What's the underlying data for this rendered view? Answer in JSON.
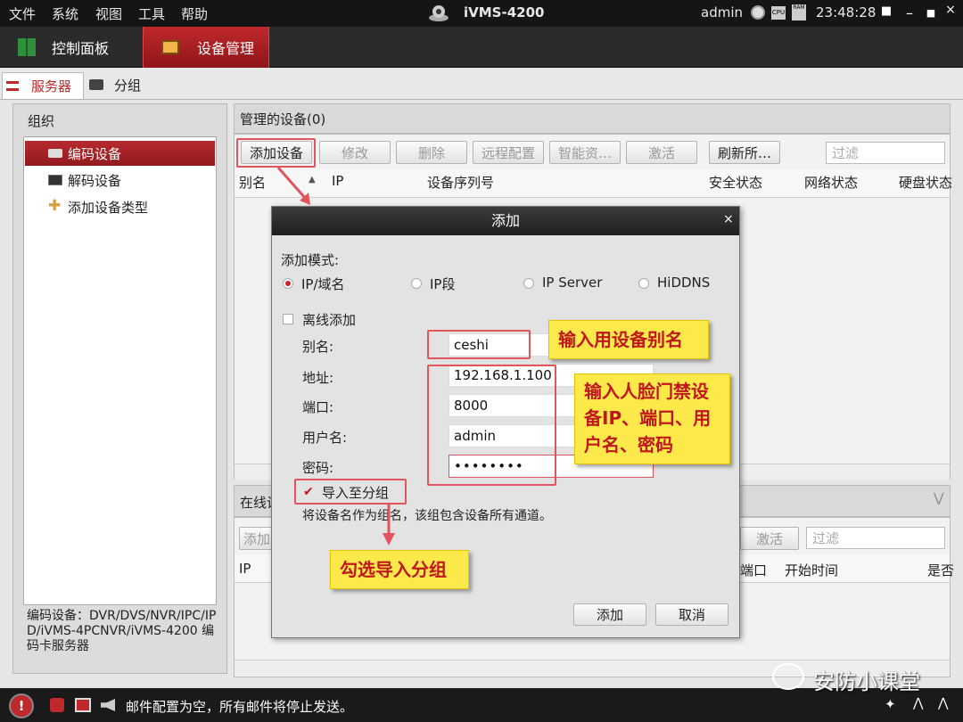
{
  "menu": [
    "文件",
    "系统",
    "视图",
    "工具",
    "帮助"
  ],
  "app": {
    "title": "iVMS-4200",
    "user": "admin",
    "time": "23:48:28"
  },
  "tabs": [
    {
      "label": "控制面板"
    },
    {
      "label": "设备管理"
    }
  ],
  "subtabs": [
    {
      "label": "服务器"
    },
    {
      "label": "分组"
    }
  ],
  "left": {
    "header": "组织",
    "items": [
      "编码设备",
      "解码设备",
      "添加设备类型"
    ],
    "desc": "编码设备：DVR/DVS/NVR/IPC/IPD/iVMS-4PCNVR/iVMS-4200 编码卡服务器"
  },
  "managed": {
    "header": "管理的设备(0)",
    "buttons": [
      "添加设备",
      "修改",
      "删除",
      "远程配置",
      "智能资…",
      "激活",
      "刷新所…"
    ],
    "filter_placeholder": "过滤",
    "columns": [
      "别名",
      "IP",
      "设备序列号",
      "安全状态",
      "网络状态",
      "硬盘状态"
    ]
  },
  "online": {
    "header": "在线设",
    "add_btn": "添加",
    "activate_btn": "激活",
    "filter_placeholder": "过滤",
    "columns": [
      "IP",
      "端口",
      "开始时间",
      "是否"
    ]
  },
  "dialog": {
    "title": "添加",
    "mode_label": "添加模式:",
    "modes": [
      "IP/域名",
      "IP段",
      "IP Server",
      "HiDDNS"
    ],
    "offline_label": "离线添加",
    "alias_label": "别名:",
    "alias": "ceshi",
    "address_label": "地址:",
    "address": "192.168.1.100",
    "port_label": "端口:",
    "port": "8000",
    "user_label": "用户名:",
    "user": "admin",
    "password_label": "密码:",
    "password": "••••••••",
    "import_label": "导入至分组",
    "import_desc": "将设备名作为组名，该组包含设备所有通道。",
    "ok": "添加",
    "cancel": "取消"
  },
  "callouts": {
    "alias": "输入用设备别名",
    "device": "输入人脸门禁设备IP、端口、用户名、密码",
    "group": "勾选导入分组"
  },
  "status": {
    "message": "邮件配置为空，所有邮件将停止发送。",
    "watermark": "安防小课堂"
  },
  "colors": {
    "accent": "#c0292c",
    "highlight": "#fde94a",
    "annotation": "#e2555d"
  }
}
